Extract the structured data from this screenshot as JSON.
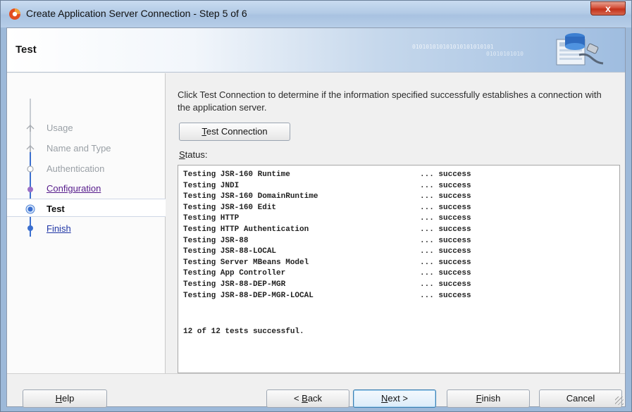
{
  "window": {
    "title": "Create Application Server Connection - Step 5 of 6",
    "close_label": "x"
  },
  "header": {
    "title": "Test",
    "binary_text": "010101010101010101010101",
    "binary_text_2": "01010101010"
  },
  "nav": {
    "items": [
      {
        "label": "Usage",
        "state": "done"
      },
      {
        "label": "Name and Type",
        "state": "done"
      },
      {
        "label": "Authentication",
        "state": "done"
      },
      {
        "label": "Configuration",
        "state": "visited"
      },
      {
        "label": "Test",
        "state": "current"
      },
      {
        "label": "Finish",
        "state": "link"
      }
    ]
  },
  "content": {
    "description": "Click Test Connection to determine if the information specified successfully establishes a connection with the application server.",
    "test_button": {
      "pre": "",
      "mn": "T",
      "post": "est Connection"
    },
    "status_label": {
      "mn": "S",
      "post": "tatus:"
    },
    "status_rows": [
      {
        "test": "Testing JSR-160 Runtime",
        "result": "... success"
      },
      {
        "test": "Testing JNDI",
        "result": "... success"
      },
      {
        "test": "Testing JSR-160 DomainRuntime",
        "result": "... success"
      },
      {
        "test": "Testing JSR-160 Edit",
        "result": "... success"
      },
      {
        "test": "Testing HTTP",
        "result": "... success"
      },
      {
        "test": "Testing HTTP Authentication",
        "result": "... success"
      },
      {
        "test": "Testing JSR-88",
        "result": "... success"
      },
      {
        "test": "Testing JSR-88-LOCAL",
        "result": "... success"
      },
      {
        "test": "Testing Server MBeans Model",
        "result": "... success"
      },
      {
        "test": "Testing App Controller",
        "result": "... success"
      },
      {
        "test": "Testing JSR-88-DEP-MGR",
        "result": "... success"
      },
      {
        "test": "Testing JSR-88-DEP-MGR-LOCAL",
        "result": "... success"
      }
    ],
    "summary": "12 of 12 tests successful."
  },
  "footer": {
    "help": {
      "pre": "",
      "mn": "H",
      "post": "elp"
    },
    "back": {
      "pre": "< ",
      "mn": "B",
      "post": "ack"
    },
    "next": {
      "pre": "",
      "mn": "N",
      "post": "ext >"
    },
    "finish": {
      "pre": "",
      "mn": "F",
      "post": "inish"
    },
    "cancel": {
      "label": "Cancel"
    }
  },
  "colors": {
    "link": "#1f35a5",
    "visited": "#551a8b",
    "done": "#9aa0a6",
    "accent": "#3c7fb1"
  }
}
